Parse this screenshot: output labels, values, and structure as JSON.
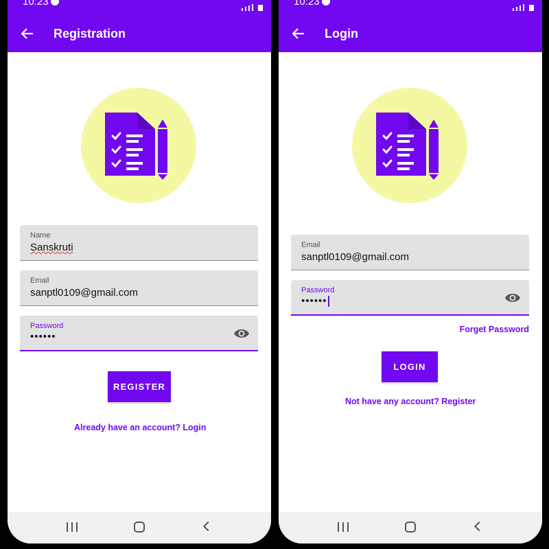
{
  "colors": {
    "primary": "#7108f0",
    "logo_bg": "#f4f8a2",
    "field_bg": "#e2e2e2"
  },
  "registration": {
    "status_time": "10:23",
    "title": "Registration",
    "name_label": "Name",
    "name_value": "Sanskruti",
    "email_label": "Email",
    "email_value": "sanptl0109@gmail.com",
    "password_label": "Password",
    "password_value": "••••••",
    "register_button": "REGISTER",
    "login_link": "Already have an account? Login"
  },
  "login": {
    "status_time": "10:23",
    "title": "Login",
    "email_label": "Email",
    "email_value": "sanptl0109@gmail.com",
    "password_label": "Password",
    "password_value": "••••••",
    "forget_password": "Forget Password",
    "login_button": "LOGIN",
    "register_link": "Not have any account? Register"
  },
  "icons": [
    "arrow-back-icon",
    "checklist-icon",
    "pen-icon",
    "eye-icon",
    "recent-apps-icon",
    "home-icon",
    "back-nav-icon"
  ]
}
